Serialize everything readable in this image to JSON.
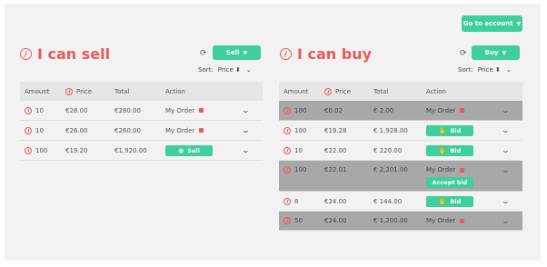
{
  "header": {
    "goto_account_label": "Go to account"
  },
  "sell": {
    "title": "I can sell",
    "dropdown_label": "Sell",
    "sort_label": "Sort:",
    "sort_value": "Price",
    "columns": [
      "Amount",
      "Price",
      "Total",
      "Action"
    ],
    "rows": [
      {
        "amount": "10",
        "price": "€28.00",
        "total": "€280.00",
        "action": "My Order"
      },
      {
        "amount": "10",
        "price": "€26.00",
        "total": "€260.00",
        "action": "My Order"
      },
      {
        "amount": "100",
        "price": "€19.20",
        "total": "€1,920.00",
        "action": "Sell"
      }
    ]
  },
  "buy": {
    "title": "I can buy",
    "dropdown_label": "Buy",
    "sort_label": "Sort:",
    "sort_value": "Price",
    "columns": [
      "Amount",
      "Price",
      "Total",
      "Action"
    ],
    "rows": [
      {
        "amount": "100",
        "price": "€0.02",
        "total": "€ 2.00",
        "action": "My Order"
      },
      {
        "amount": "100",
        "price": "€19.28",
        "total": "€ 1,928.00",
        "action": "Bid"
      },
      {
        "amount": "10",
        "price": "€22.00",
        "total": "€ 220.00",
        "action": "Bid"
      },
      {
        "amount": "100",
        "price": "€22.01",
        "total": "€ 2,201.00",
        "action": "My Order",
        "extra_action": "Accept bid"
      },
      {
        "amount": "6",
        "price": "€24.00",
        "total": "€ 144.00",
        "action": "Bid"
      },
      {
        "amount": "50",
        "price": "€24.00",
        "total": "€ 1,200.00",
        "action": "My Order"
      }
    ]
  },
  "icons": {
    "coin": "coin-icon",
    "refresh": "refresh-icon",
    "chevron": "chevron-down-icon",
    "eye": "eye-icon",
    "hand": "hand-icon",
    "order_badge": "order-badge-icon",
    "caret": "caret-down-icon"
  },
  "colors": {
    "accent": "#3ecf9b",
    "title": "#e95a57",
    "highlight_row": "#a8a8a8",
    "header_row": "#e6e6e6"
  }
}
